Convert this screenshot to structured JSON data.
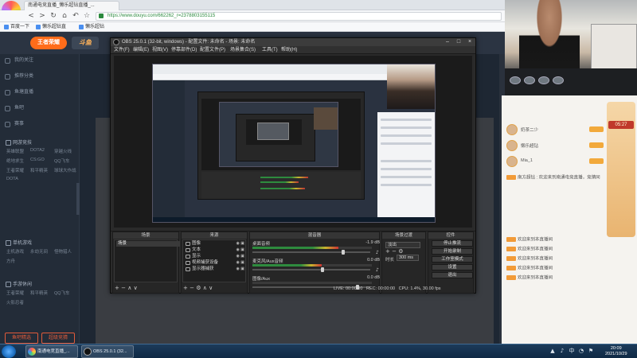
{
  "browser": {
    "tab_title": "南通电竞直播_懒乐超钻直播_...",
    "logo_label": "2345手游助手",
    "url": "https://www.douyu.com/662262_r=2378803155115",
    "bookmarks": [
      "百度一下",
      "懒乐超钻直",
      "懒乐超钻"
    ]
  },
  "site": {
    "logo": "王者荣耀",
    "logo2": "斗鱼",
    "sidebar": {
      "items": [
        {
          "label": "我的关注",
          "icon": "heart-icon"
        },
        {
          "label": "推荐分类",
          "icon": "grid-icon"
        },
        {
          "label": "鱼塘直播",
          "icon": "fish-icon"
        },
        {
          "label": "鱼吧",
          "icon": "chat-icon"
        },
        {
          "label": "赛事",
          "icon": "trophy-icon"
        }
      ],
      "sections": [
        {
          "title": "网游竞技",
          "links": [
            "英雄联盟",
            "DOTA2",
            "穿越火线",
            "绝地求生",
            "CS:GO",
            "QQ飞车",
            "王者荣耀",
            "和平精英",
            "球球大作战",
            "DOTA"
          ]
        },
        {
          "title": "单机游戏",
          "links": [
            "主机游戏",
            "永劫无间",
            "怪物猎人",
            "方舟"
          ]
        },
        {
          "title": "手游休闲",
          "links": [
            "王者荣耀",
            "和平精英",
            "QQ飞车",
            "火影忍者"
          ]
        }
      ],
      "button_left": "鱼吧精选",
      "button_right": "超级竞猜"
    }
  },
  "obs": {
    "title": "OBS 25.0.1 (32-bit, windows) - 配置文件: 未命名 - 场景: 未命名",
    "menu": [
      "文件(F)",
      "编辑(E)",
      "视图(V)",
      "停靠部件(D)",
      "配置文件(P)",
      "场景集合(S)",
      "工具(T)",
      "帮助(H)"
    ],
    "docks": {
      "scenes": {
        "title": "场景",
        "items": [
          "场景"
        ]
      },
      "sources": {
        "title": "来源",
        "items": [
          "图像",
          "文本",
          "显示",
          "视频捕获设备",
          "显示器捕获"
        ]
      },
      "mixer": {
        "title": "混音器",
        "tracks": [
          {
            "name": "桌面音频",
            "db": "-1.9 dB",
            "level": 0.72,
            "volume": 0.78
          },
          {
            "name": "麦克风/Aux音频",
            "db": "0.0 dB",
            "level": 0.58,
            "volume": 0.6
          },
          {
            "name": "图像/Aux",
            "db": "0.0 dB",
            "level": 0.0,
            "volume": 0.9
          }
        ]
      },
      "transitions": {
        "title": "场景过渡",
        "selected": "淡出",
        "duration_label": "时长",
        "duration": "300 ms"
      },
      "controls": {
        "title": "控件",
        "buttons": [
          "停止推流",
          "开始录制",
          "工作室模式",
          "设置",
          "退出"
        ]
      }
    },
    "status": {
      "live": "LIVE: 00:00:00",
      "rec": "REC: 00:00:00",
      "cpu": "CPU: 1.4%, 30.00 fps"
    }
  },
  "right_panel": {
    "users": [
      {
        "name": "奶茶二少"
      },
      {
        "name": "懒乐超钻"
      },
      {
        "name": "Mia_1"
      }
    ],
    "timer": "05:27",
    "chat": [
      "南方超钻 : 欢迎来到南通电竞直播，竞猜同",
      "欢迎来到本直播间",
      "欢迎来到本直播间",
      "欢迎来到本直播间",
      "欢迎来到本直播间",
      "欢迎来到本直播间"
    ]
  },
  "taskbar": {
    "items": [
      "南通电竞直播_...",
      "OBS 25.0.1 (32..."
    ],
    "time": "20:09",
    "date": "2021/10/29"
  }
}
